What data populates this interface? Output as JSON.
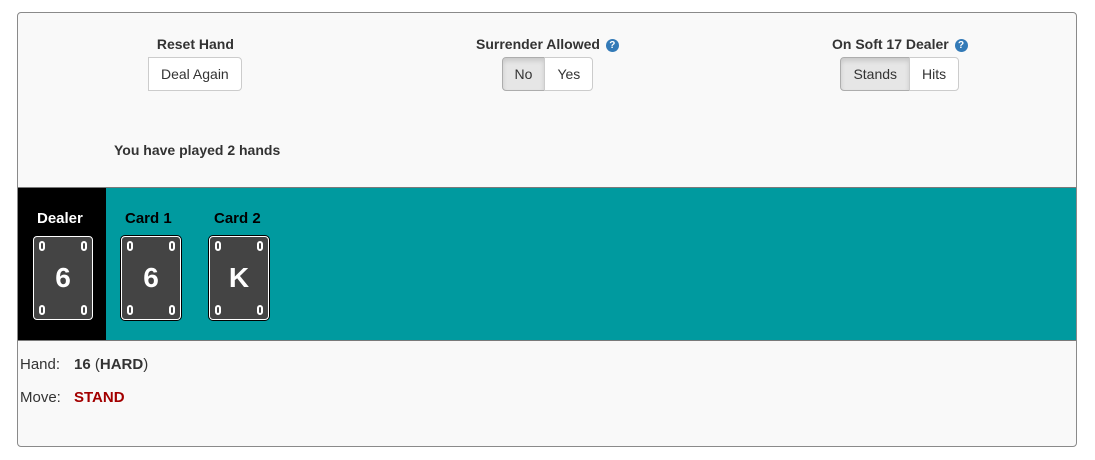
{
  "controls": {
    "reset": {
      "label": "Reset Hand",
      "button": "Deal Again"
    },
    "surrender": {
      "label": "Surrender Allowed",
      "help": "?",
      "options": [
        "No",
        "Yes"
      ],
      "selected": "No"
    },
    "soft17": {
      "label": "On Soft 17 Dealer",
      "help": "?",
      "options": [
        "Stands",
        "Hits"
      ],
      "selected": "Stands"
    }
  },
  "status": {
    "hands_played": "You have played 2 hands"
  },
  "table": {
    "dealer": {
      "label": "Dealer",
      "card": "6"
    },
    "cards": [
      {
        "label": "Card 1",
        "value": "6"
      },
      {
        "label": "Card 2",
        "value": "K"
      }
    ]
  },
  "result": {
    "hand_label": "Hand:",
    "hand_total": "16",
    "hand_type": "HARD",
    "move_label": "Move:",
    "move_value": "STAND"
  },
  "colors": {
    "table_bg": "#009a9f",
    "dealer_bg": "#000000",
    "card_bg": "#444444",
    "move_color": "#a30000",
    "help_icon": "#337ab7"
  }
}
